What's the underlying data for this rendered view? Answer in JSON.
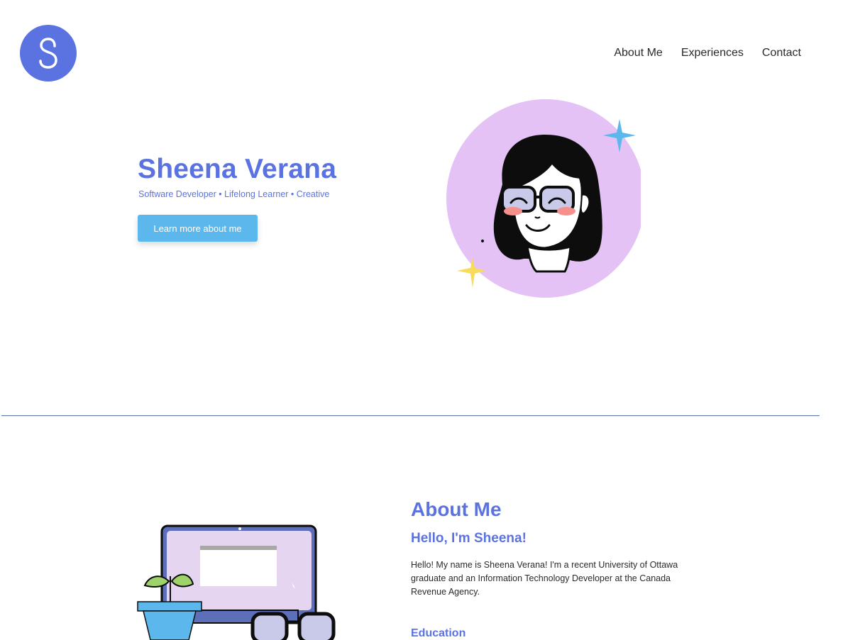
{
  "header": {
    "logo_letter": "S",
    "nav": [
      "About Me",
      "Experiences",
      "Contact"
    ]
  },
  "hero": {
    "name": "Sheena Verana",
    "tagline": "Software Developer • Lifelong Learner • Creative",
    "cta_label": "Learn more about me"
  },
  "about": {
    "title": "About Me",
    "subtitle": "Hello, I'm Sheena!",
    "text": "Hello! My name is Sheena Verana! I'm a recent University of Ottawa graduate and an Information Technology Developer at the Canada Revenue Agency.",
    "education_title": "Education"
  },
  "colors": {
    "accent": "#5a73e0",
    "button": "#5bb7ec",
    "avatar_bg": "#e4c2f5",
    "divider": "#5a73a8"
  },
  "icons": {
    "logo": "s-logo-icon",
    "avatar": "girl-avatar-illustration",
    "sparkles": [
      "blue-sparkle-icon",
      "yellow-sparkle-icon"
    ],
    "laptop": "laptop-illustration",
    "plant": "plant-icon",
    "glasses": "glasses-icon"
  }
}
